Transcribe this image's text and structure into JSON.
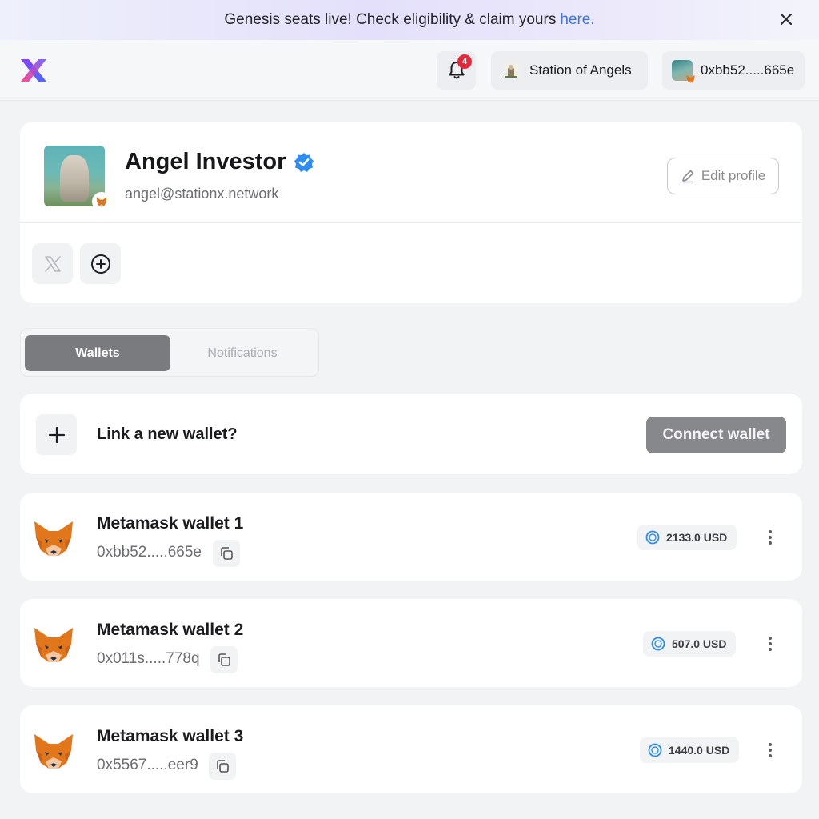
{
  "banner": {
    "text": "Genesis seats live! Check eligibility & claim yours",
    "link_text": "here.",
    "close_icon": "close-icon"
  },
  "header": {
    "notification_count": "4",
    "station_name": "Station of Angels",
    "wallet_address": "0xbb52.....665e"
  },
  "profile": {
    "name": "Angel Investor",
    "email": "angel@stationx.network",
    "edit_label": "Edit profile",
    "verified": true
  },
  "tabs": {
    "wallets": "Wallets",
    "notifications": "Notifications",
    "active": "Wallets"
  },
  "link_wallet": {
    "prompt": "Link a new wallet?",
    "button": "Connect wallet"
  },
  "wallets": [
    {
      "name": "Metamask wallet 1",
      "address": "0xbb52.....665e",
      "balance": "2133.0 USD"
    },
    {
      "name": "Metamask wallet 2",
      "address": "0x011s.....778q",
      "balance": "507.0 USD"
    },
    {
      "name": "Metamask wallet 3",
      "address": "0x5567.....eer9",
      "balance": "1440.0 USD"
    }
  ],
  "colors": {
    "primary_gray": "#7a7b7f",
    "connect_button": "#87888c",
    "verified_blue": "#2f8cf0",
    "badge_red": "#e5293b",
    "link_blue": "#3a73e8",
    "usdc_blue": "#2f8cf0"
  }
}
